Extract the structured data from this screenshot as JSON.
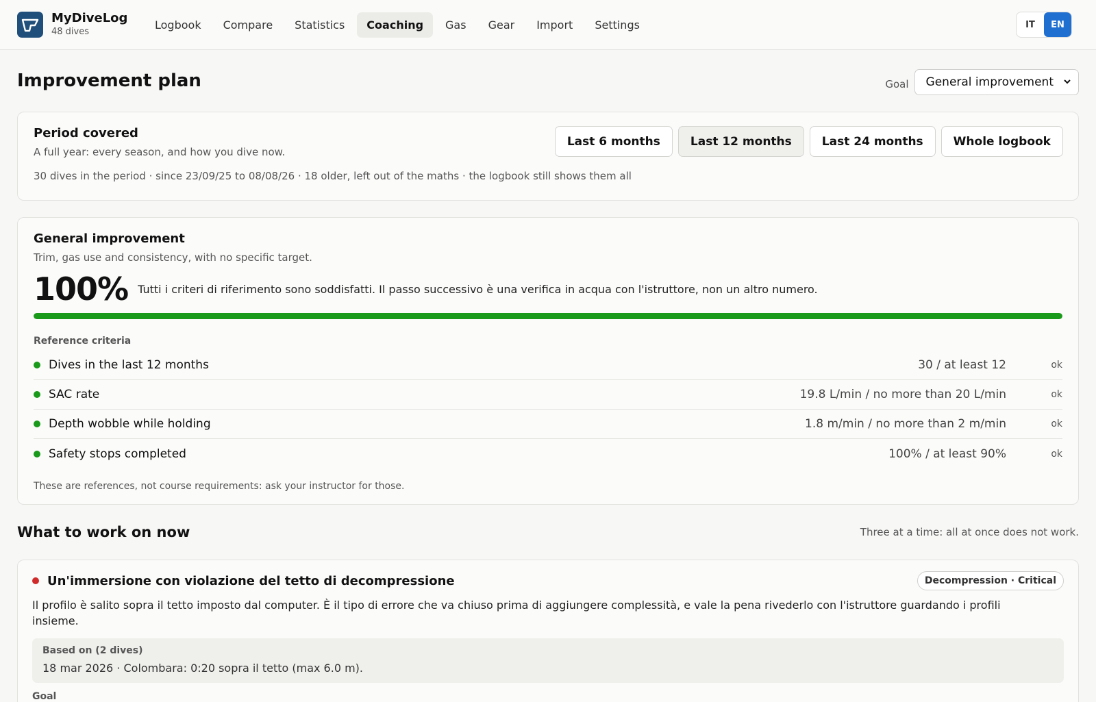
{
  "app": {
    "name": "MyDiveLog",
    "count": "48 dives"
  },
  "nav": [
    {
      "label": "Logbook"
    },
    {
      "label": "Compare"
    },
    {
      "label": "Statistics"
    },
    {
      "label": "Coaching",
      "active": true
    },
    {
      "label": "Gas"
    },
    {
      "label": "Gear"
    },
    {
      "label": "Import"
    },
    {
      "label": "Settings"
    }
  ],
  "lang": {
    "it": "IT",
    "en": "EN",
    "selected": "EN"
  },
  "page": {
    "title": "Improvement plan",
    "goal_label": "Goal",
    "goal_value": "General improvement"
  },
  "period": {
    "title": "Period covered",
    "desc": "A full year: every season, and how you dive now.",
    "meta": "30 dives in the period · since 23/09/25 to 08/08/26 · 18 older, left out of the maths · the logbook still shows them all",
    "ranges": [
      "Last 6 months",
      "Last 12 months",
      "Last 24 months",
      "Whole logbook"
    ],
    "selected": "Last 12 months"
  },
  "goal": {
    "title": "General improvement",
    "desc": "Trim, gas use and consistency, with no specific target.",
    "percent_label": "100%",
    "percent": 100,
    "summary": "Tutti i criteri di riferimento sono soddisfatti. Il passo successivo è una verifica in acqua con l'istruttore, non un altro numero.",
    "criteria_heading": "Reference criteria",
    "criteria": [
      {
        "name": "Dives in the last 12 months",
        "value": "30 / at least 12",
        "status": "ok"
      },
      {
        "name": "SAC rate",
        "value": "19.8 L/min / no more than 20 L/min",
        "status": "ok"
      },
      {
        "name": "Depth wobble while holding",
        "value": "1.8 m/min / no more than 2 m/min",
        "status": "ok"
      },
      {
        "name": "Safety stops completed",
        "value": "100% / at least 90%",
        "status": "ok"
      }
    ],
    "footnote": "These are references, not course requirements: ask your instructor for those."
  },
  "work": {
    "title": "What to work on now",
    "note": "Three at a time: all at once does not work.",
    "issue": {
      "title": "Un'immersione con violazione del tetto di decompressione",
      "tag": "Decompression · Critical",
      "body": "Il profilo è salito sopra il tetto imposto dal computer. È il tipo di errore che va chiuso prima di aggiungere complessità, e vale la pena rivederlo con l'istruttore guardando i profili insieme.",
      "evidence_head": "Based on (2 dives)",
      "evidence_text": "18 mar 2026 · Colombara: 0:20 sopra il tetto (max 6.0 m).",
      "goal_label": "Goal"
    }
  },
  "colors": {
    "accent": "#1f6fd1",
    "ok": "#1a9a1a",
    "critical": "#d02a2a",
    "logo": "#1f4f7a"
  }
}
